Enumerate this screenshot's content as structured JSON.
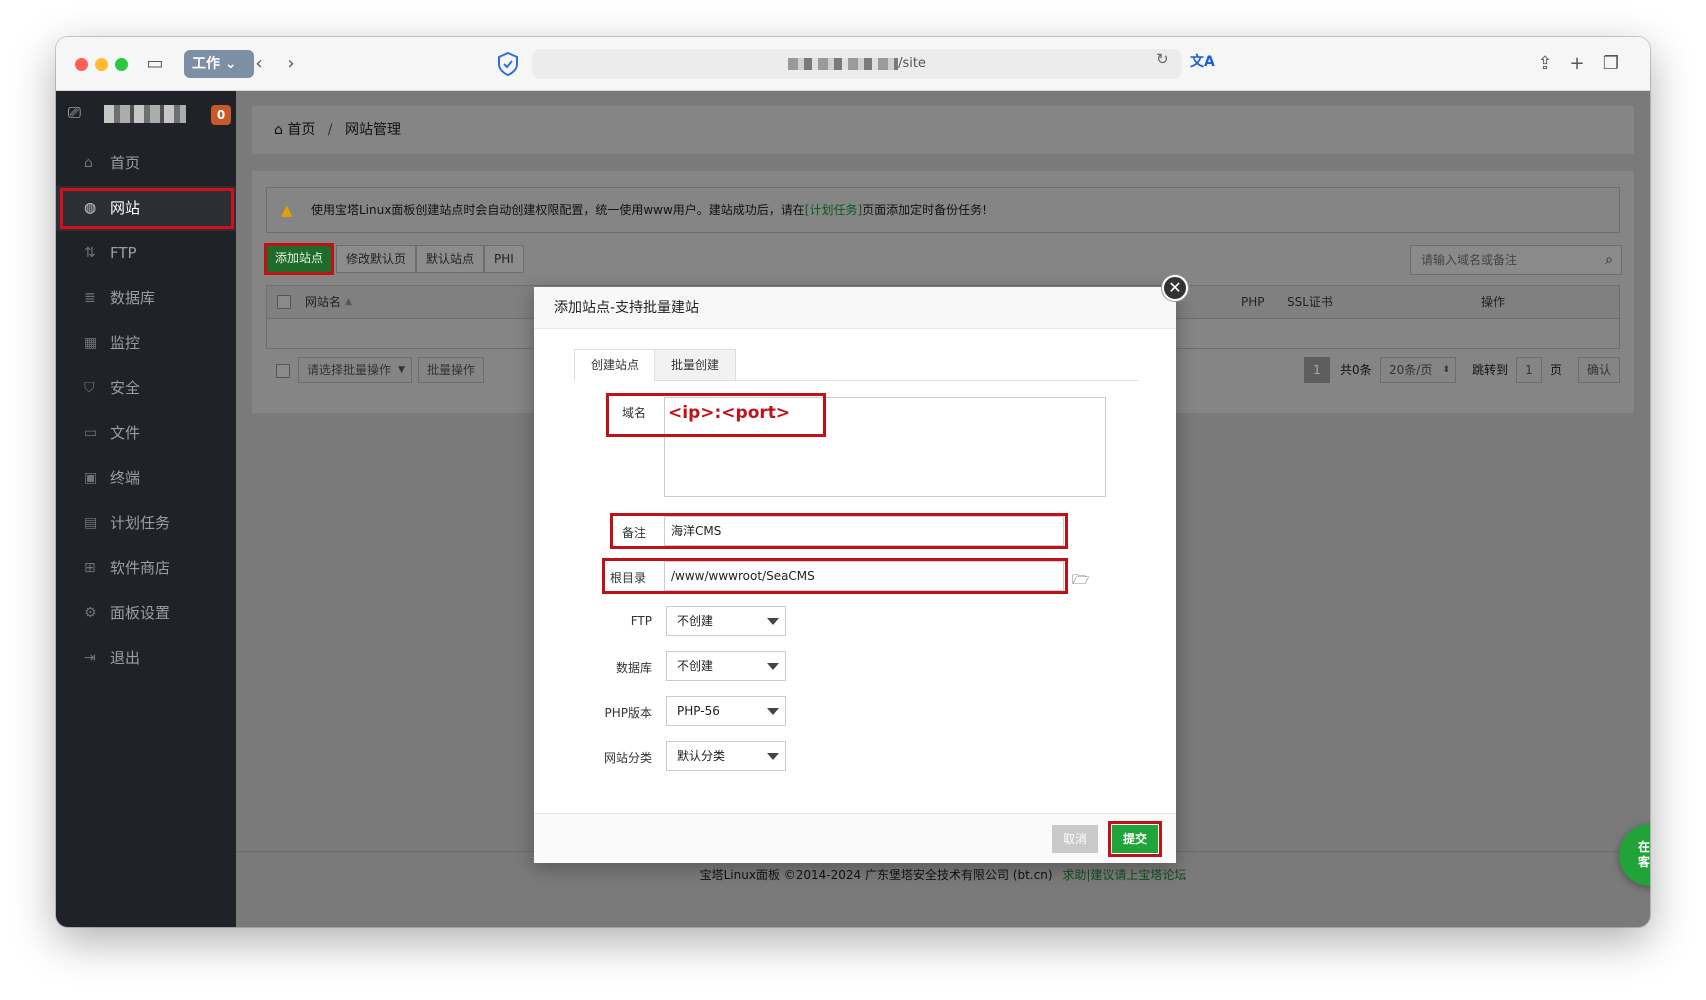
{
  "browser": {
    "workspace_label": "工作",
    "url_visible": "/site"
  },
  "sidebar": {
    "badge": "0",
    "items": [
      {
        "label": "首页",
        "icon": "home-icon"
      },
      {
        "label": "网站",
        "icon": "globe-icon",
        "active": true
      },
      {
        "label": "FTP",
        "icon": "ftp-icon"
      },
      {
        "label": "数据库",
        "icon": "database-icon"
      },
      {
        "label": "监控",
        "icon": "monitor-icon"
      },
      {
        "label": "安全",
        "icon": "shield-icon"
      },
      {
        "label": "文件",
        "icon": "folder-icon"
      },
      {
        "label": "终端",
        "icon": "terminal-icon"
      },
      {
        "label": "计划任务",
        "icon": "calendar-icon"
      },
      {
        "label": "软件商店",
        "icon": "grid-icon"
      },
      {
        "label": "面板设置",
        "icon": "gear-icon"
      },
      {
        "label": "退出",
        "icon": "logout-icon"
      }
    ]
  },
  "breadcrumb": {
    "home": "首页",
    "separator": "/",
    "current": "网站管理"
  },
  "notice": {
    "text_before": "使用宝塔Linux面板创建站点时会自动创建权限配置，统一使用www用户。建站成功后，请在",
    "link": "[计划任务]",
    "text_after": "页面添加定时备份任务!"
  },
  "toolbar": {
    "add_site": "添加站点",
    "modify_default": "修改默认页",
    "default_site": "默认站点",
    "php_partial": "PHI",
    "search_placeholder": "请输入域名或备注"
  },
  "table": {
    "col_site": "网站名",
    "col_php": "PHP",
    "col_ssl": "SSL证书",
    "col_action": "操作"
  },
  "bulk": {
    "select_placeholder": "请选择批量操作",
    "button": "批量操作"
  },
  "pager": {
    "current_page": "1",
    "total": "共0条",
    "per_page": "20条/页",
    "jump_label": "跳转到",
    "jump_value": "1",
    "page_suffix": "页",
    "confirm": "确认"
  },
  "footer": {
    "copyright": "宝塔Linux面板 ©2014-2024 广东堡塔安全技术有限公司 (bt.cn)",
    "link": "求助|建议请上宝塔论坛"
  },
  "chat": {
    "line1": "在线",
    "line2": "客服"
  },
  "modal": {
    "title": "添加站点-支持批量建站",
    "tabs": [
      "创建站点",
      "批量创建"
    ],
    "fields": {
      "domain_label": "域名",
      "domain_value": "<ip>:<port>",
      "remark_label": "备注",
      "remark_value": "海洋CMS",
      "root_label": "根目录",
      "root_value": "/www/wwwroot/SeaCMS",
      "ftp_label": "FTP",
      "ftp_value": "不创建",
      "db_label": "数据库",
      "db_value": "不创建",
      "php_label": "PHP版本",
      "php_value": "PHP-56",
      "category_label": "网站分类",
      "category_value": "默认分类"
    },
    "cancel": "取消",
    "submit": "提交"
  },
  "colors": {
    "accent_green": "#20a53a",
    "highlight_red": "#c01018",
    "sidebar_bg": "#1f2327",
    "badge_orange": "#c75a2c"
  }
}
